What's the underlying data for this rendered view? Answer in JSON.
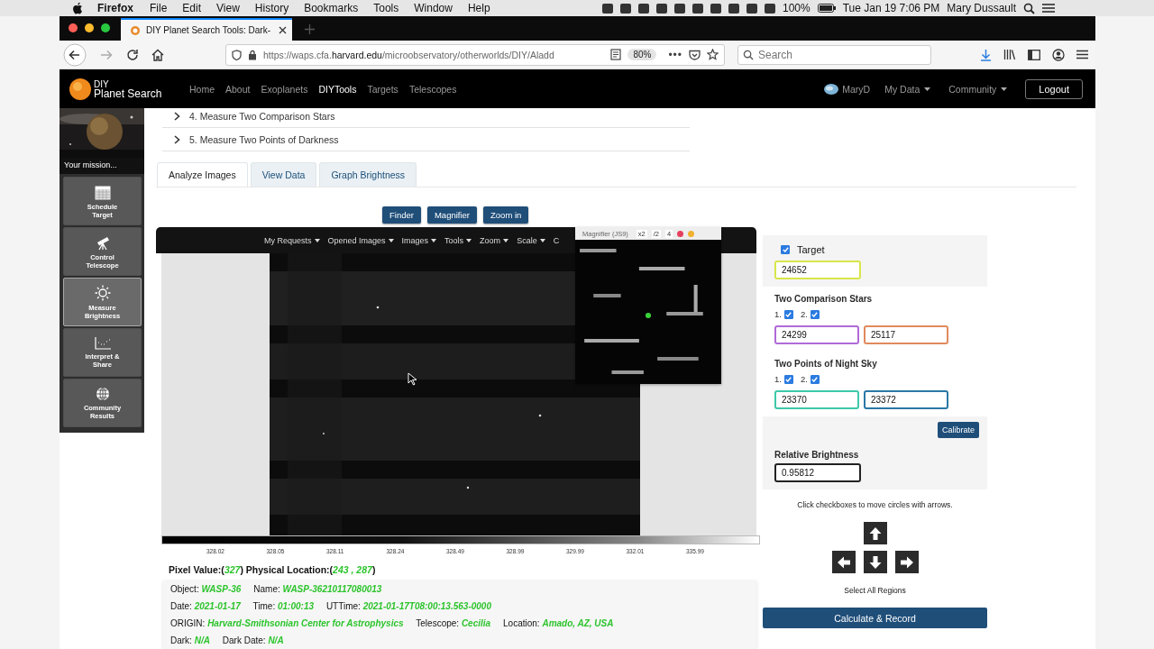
{
  "menubar": {
    "app": "Firefox",
    "menus": [
      "File",
      "Edit",
      "View",
      "History",
      "Bookmarks",
      "Tools",
      "Window",
      "Help"
    ],
    "battery": "100%",
    "clock": "Tue Jan 19  7:06 PM",
    "user": "Mary Dussault"
  },
  "browser": {
    "tab": {
      "title": "DIY Planet Search Tools: Dark-",
      "selected": true
    },
    "url": "https://waps.cfa.**harvard.edu**/microobservatory/otherworlds/DIY/Aladd",
    "zoom": "80%",
    "more": "•••",
    "search_placeholder": "Search"
  },
  "site": {
    "logo": {
      "top": "DIY",
      "bottom": "Planet Search"
    },
    "nav": [
      {
        "label": "Home",
        "selected": false
      },
      {
        "label": "About",
        "selected": false
      },
      {
        "label": "Exoplanets",
        "selected": false
      },
      {
        "label": "DIYTools",
        "selected": true
      },
      {
        "label": "Targets",
        "selected": false
      },
      {
        "label": "Telescopes",
        "selected": false
      }
    ],
    "user": "MaryD",
    "menus": [
      "My Data",
      "Community"
    ],
    "logout": "Logout"
  },
  "sidebar": {
    "mission": "Your mission...",
    "items": [
      {
        "label": "Schedule Target",
        "kind": "calendar",
        "selected": false
      },
      {
        "label": "Control Telescope",
        "kind": "telescope",
        "selected": false
      },
      {
        "label": "Measure Brightness",
        "kind": "sun",
        "selected": true
      },
      {
        "label": "Interpret & Share",
        "kind": "chart",
        "selected": false
      },
      {
        "label": "Community Results",
        "kind": "globe",
        "selected": false
      }
    ]
  },
  "steps": [
    {
      "label": "4. Measure Two Comparison Stars",
      "expanded": false
    },
    {
      "label": "5. Measure Two Points of Darkness",
      "expanded": false
    }
  ],
  "tabs": [
    {
      "label": "Analyze Images",
      "selected": true
    },
    {
      "label": "View Data",
      "selected": false
    },
    {
      "label": "Graph Brightness",
      "selected": false
    }
  ],
  "viewer_buttons": [
    "Finder",
    "Magnifier",
    "Zoom in"
  ],
  "viewer": {
    "menus": [
      "My Requests",
      "Opened Images",
      "Images",
      "Tools",
      "Zoom",
      "Scale"
    ],
    "cut_menu": "C",
    "magnifier": {
      "title": "Magnifier (JS9)",
      "buttons": [
        "x2",
        "/2",
        "4"
      ]
    },
    "colorbar_ticks": [
      "328.02",
      "328.05",
      "328.11",
      "328.24",
      "328.49",
      "328.99",
      "329.99",
      "332.01",
      "335.99"
    ]
  },
  "info": {
    "pixel_line": "Pixel Value:(*327*) Physical Location:(*243 , 287*)",
    "rows": [
      "Object: *WASP-36*     Name: *WASP-36210117080013*",
      "Date: *2021-01-17*     Time: *01:00:13*     UTTime: *2021-01-17T08:00:13.563-0000*",
      "ORIGIN: *Harvard-Smithsonian Center for Astrophysics*     Telescope: *Cecilia*     Location: *Amado, AZ, USA*",
      "Dark: *N/A*     Dark Date: *N/A*"
    ]
  },
  "panel": {
    "target": {
      "label": "Target",
      "checked": true,
      "value": "24652",
      "color": "#d8e64a"
    },
    "comparison": {
      "title": "Two Comparison Stars",
      "checks": [
        {
          "label": "1.",
          "checked": true
        },
        {
          "label": "2.",
          "checked": true
        }
      ],
      "fields": [
        {
          "value": "24299",
          "color": "#b06ad8"
        },
        {
          "value": "25117",
          "color": "#e08a5c"
        }
      ]
    },
    "night_sky": {
      "title": "Two Points of Night Sky",
      "checks": [
        {
          "label": "1.",
          "checked": true
        },
        {
          "label": "2.",
          "checked": true
        }
      ],
      "fields": [
        {
          "value": "23370",
          "color": "#3cc9a8"
        },
        {
          "value": "23372",
          "color": "#2a78a6"
        }
      ]
    },
    "calibrate": "Calibrate",
    "relative": {
      "label": "Relative Brightness",
      "value": "0.95812"
    },
    "hint": "Click checkboxes to move circles with arrows.",
    "select_all": "Select All Regions",
    "calculate": "Calculate & Record"
  }
}
